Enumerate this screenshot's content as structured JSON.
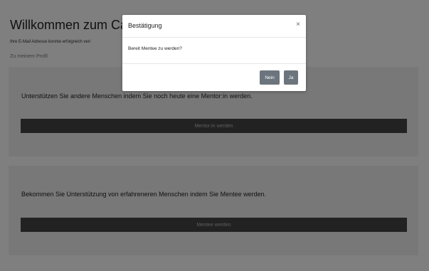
{
  "page": {
    "title": "Willkommen zum Car",
    "subtitle": "Ihre E-Mail Adresse konnte erfolgreich veri",
    "profile_link": "Zu meinem Profil"
  },
  "cards": {
    "mentor": {
      "text": "Unterstützen Sie andere Menschen indem Sie noch heute eine Mentor:in werden.",
      "button": "Mentor:in werden"
    },
    "mentee": {
      "text": "Bekommen Sie Unterstützung von erfahreneren Menschen indem Sie Mentee werden.",
      "button": "Mentee werden"
    }
  },
  "modal": {
    "title": "Bestätigung",
    "close": "×",
    "body": "Bereit Mentee zu werden?",
    "no_label": "Nein",
    "yes_label": "Ja"
  },
  "colors": {
    "card_background": "#f0f0f0",
    "card_button": "#444444",
    "modal_button": "#6c757d",
    "backdrop": "#000000"
  }
}
